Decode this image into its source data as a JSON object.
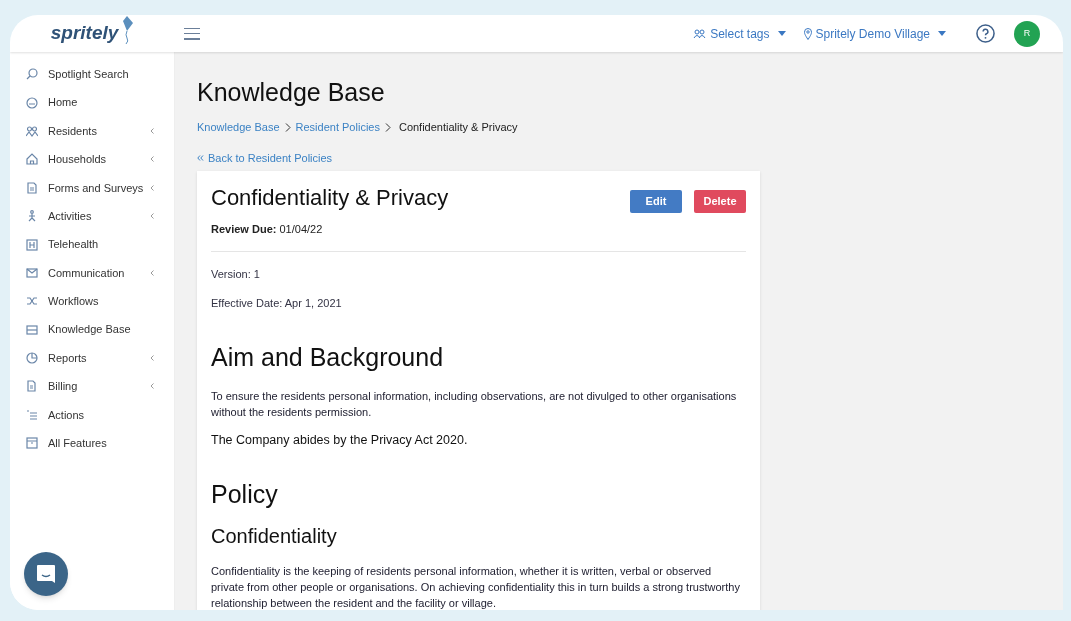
{
  "header": {
    "logo": "spritely",
    "tags_dropdown": "Select tags",
    "location_dropdown": "Spritely Demo Village",
    "avatar_initial": "R"
  },
  "sidebar": {
    "items": [
      {
        "label": "Spotlight Search",
        "has_submenu": false
      },
      {
        "label": "Home",
        "has_submenu": false
      },
      {
        "label": "Residents",
        "has_submenu": true
      },
      {
        "label": "Households",
        "has_submenu": true
      },
      {
        "label": "Forms and Surveys",
        "has_submenu": true
      },
      {
        "label": "Activities",
        "has_submenu": true
      },
      {
        "label": "Telehealth",
        "has_submenu": false
      },
      {
        "label": "Communication",
        "has_submenu": true
      },
      {
        "label": "Workflows",
        "has_submenu": false
      },
      {
        "label": "Knowledge Base",
        "has_submenu": false
      },
      {
        "label": "Reports",
        "has_submenu": true
      },
      {
        "label": "Billing",
        "has_submenu": true
      },
      {
        "label": "Actions",
        "has_submenu": false
      },
      {
        "label": "All Features",
        "has_submenu": false
      }
    ]
  },
  "page": {
    "title": "Knowledge Base",
    "breadcrumbs": [
      {
        "label": "Knowledge Base",
        "kind": "link"
      },
      {
        "label": "Resident Policies",
        "kind": "link"
      },
      {
        "label": "Confidentiality & Privacy",
        "kind": "current"
      }
    ],
    "back_link": "Back to Resident Policies"
  },
  "document": {
    "title": "Confidentiality & Privacy",
    "buttons": [
      {
        "label": "Edit",
        "kind": "primary"
      },
      {
        "label": "Delete",
        "kind": "danger"
      }
    ],
    "review_due": "**Review Due:** 01/04/22",
    "version": "Version: 1",
    "effective_date": "Effective Date: Apr 1, 2021",
    "blocks": [
      {
        "kind": "h1",
        "text": "Aim and Background"
      },
      {
        "kind": "p",
        "text": "To ensure the residents personal information, including observations, are not divulged to other organisations without the residents permission."
      },
      {
        "kind": "lead",
        "text": "The Company abides by the Privacy Act 2020."
      },
      {
        "kind": "h1",
        "text": "Policy"
      },
      {
        "kind": "h2",
        "text": "Confidentiality"
      },
      {
        "kind": "p",
        "text": "Confidentiality is the keeping of residents personal information, whether it is written, verbal or observed private from other people or organisations. On achieving confidentiality this in turn builds a strong trustworthy relationship between the resident and the facility or village."
      }
    ]
  }
}
